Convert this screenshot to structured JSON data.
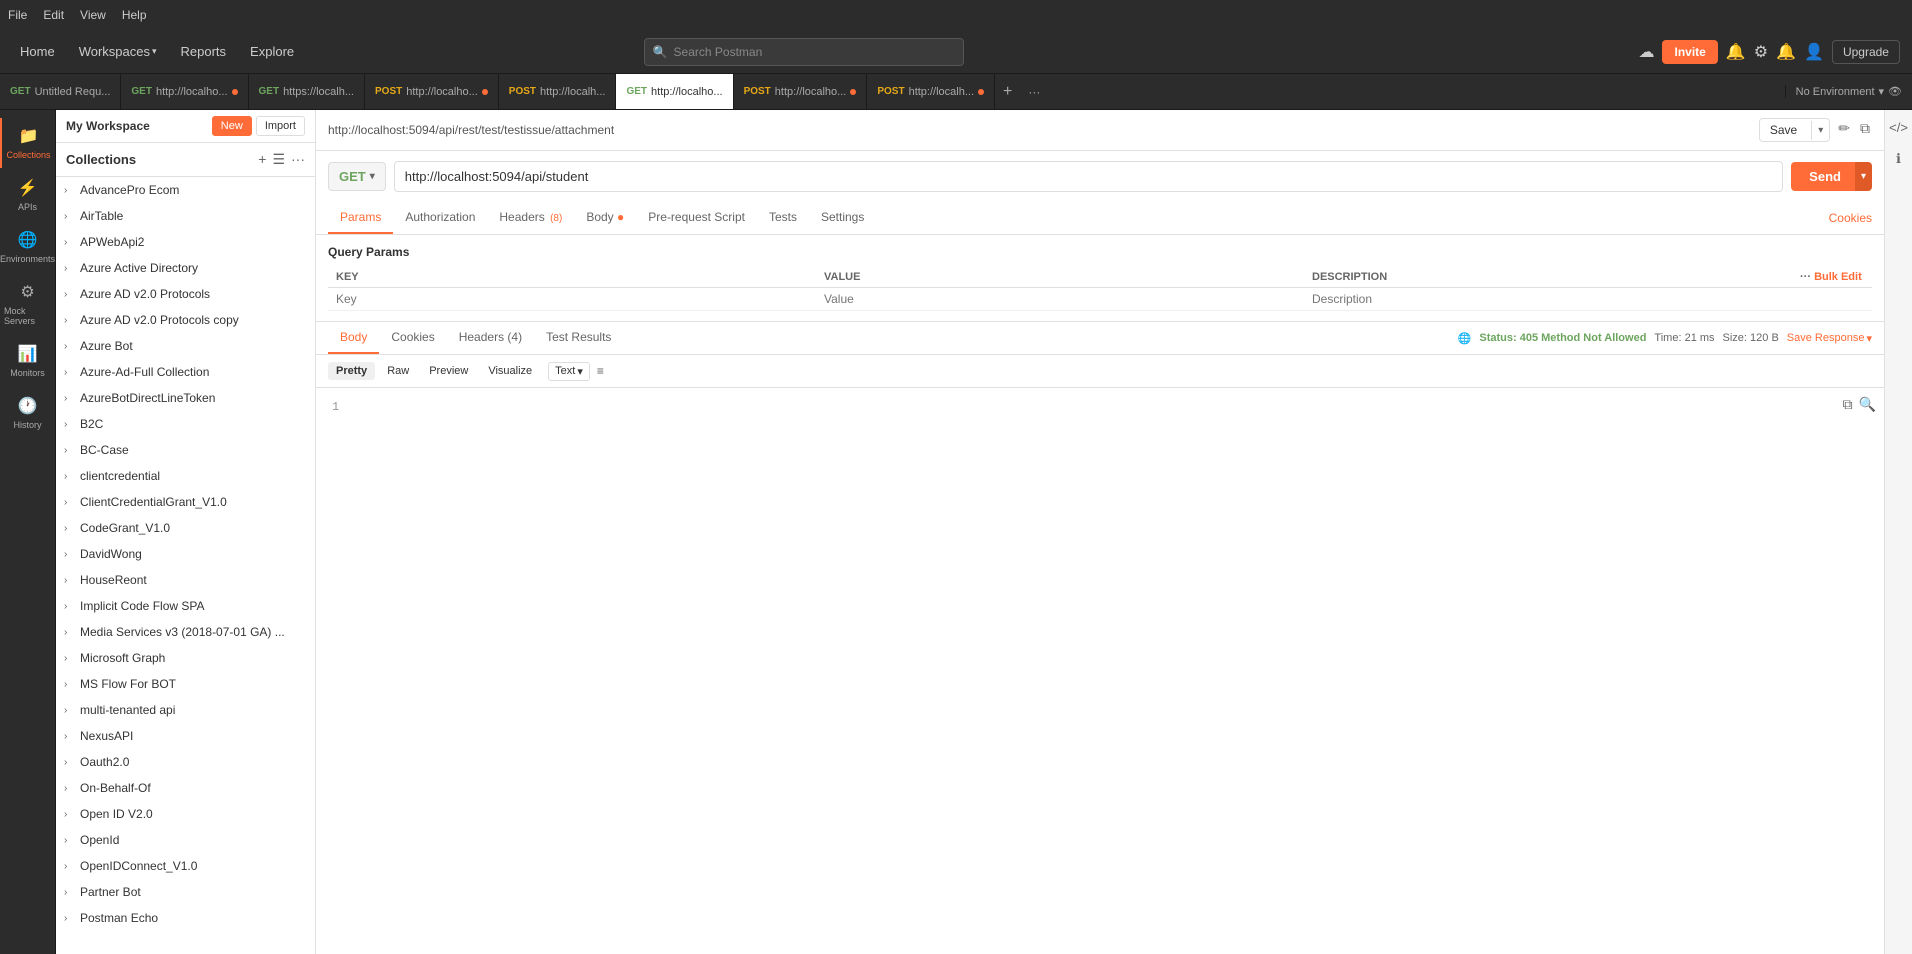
{
  "menubar": {
    "items": [
      "File",
      "Edit",
      "View",
      "Help"
    ]
  },
  "topnav": {
    "home": "Home",
    "workspaces": "Workspaces",
    "reports": "Reports",
    "explore": "Explore",
    "search_placeholder": "Search Postman",
    "invite": "Invite",
    "upgrade": "Upgrade"
  },
  "tabs": [
    {
      "method": "GET",
      "label": "Untitled Requ...",
      "has_dot": false
    },
    {
      "method": "GET",
      "label": "http://localho...",
      "has_dot": true
    },
    {
      "method": "GET",
      "label": "https://localh...",
      "has_dot": false
    },
    {
      "method": "POST",
      "label": "http://localho...",
      "has_dot": true
    },
    {
      "method": "POST",
      "label": "http://localh...",
      "has_dot": false
    },
    {
      "method": "GET",
      "label": "http://localho...",
      "has_dot": false,
      "active": true
    },
    {
      "method": "POST",
      "label": "http://localho...",
      "has_dot": true
    },
    {
      "method": "POST",
      "label": "http://localh...",
      "has_dot": true
    }
  ],
  "environment": "No Environment",
  "sidebar": {
    "items": [
      {
        "id": "collections",
        "icon": "📁",
        "label": "Collections",
        "active": true
      },
      {
        "id": "apis",
        "icon": "⚡",
        "label": "APIs"
      },
      {
        "id": "environments",
        "icon": "🌐",
        "label": "Environments"
      },
      {
        "id": "mock-servers",
        "icon": "⚙",
        "label": "Mock Servers"
      },
      {
        "id": "monitors",
        "icon": "📊",
        "label": "Monitors"
      },
      {
        "id": "history",
        "icon": "🕐",
        "label": "History"
      }
    ]
  },
  "workspace": {
    "name": "My Workspace",
    "new_label": "New",
    "import_label": "Import"
  },
  "collections": {
    "panel_title": "Collections",
    "items": [
      "AdvancePro Ecom",
      "AirTable",
      "APWebApi2",
      "Azure Active Directory",
      "Azure AD v2.0 Protocols",
      "Azure AD v2.0 Protocols copy",
      "Azure Bot",
      "Azure-Ad-Full Collection",
      "AzureBotDirectLineToken",
      "B2C",
      "BC-Case",
      "clientcredential",
      "ClientCredentialGrant_V1.0",
      "CodeGrant_V1.0",
      "DavidWong",
      "HouseReont",
      "Implicit Code Flow SPA",
      "Media Services v3 (2018-07-01 GA) ...",
      "Microsoft Graph",
      "MS Flow For BOT",
      "multi-tenanted api",
      "NexusAPI",
      "Oauth2.0",
      "On-Behalf-Of",
      "Open ID V2.0",
      "OpenId",
      "OpenIDConnect_V1.0",
      "Partner Bot",
      "Postman Echo"
    ]
  },
  "request": {
    "url_breadcrumb": "http://localhost:5094/api/rest/test/testissue/attachment",
    "method": "GET",
    "url": "http://localhost:5094/api/student",
    "send_label": "Send",
    "save_label": "Save",
    "tabs": [
      {
        "id": "params",
        "label": "Params",
        "active": true
      },
      {
        "id": "authorization",
        "label": "Authorization"
      },
      {
        "id": "headers",
        "label": "Headers",
        "badge": "(8)"
      },
      {
        "id": "body",
        "label": "Body",
        "has_dot": true
      },
      {
        "id": "prerequest",
        "label": "Pre-request Script"
      },
      {
        "id": "tests",
        "label": "Tests"
      },
      {
        "id": "settings",
        "label": "Settings"
      }
    ],
    "cookies_link": "Cookies",
    "query_params_label": "Query Params",
    "params_table": {
      "headers": [
        "KEY",
        "VALUE",
        "DESCRIPTION"
      ],
      "key_placeholder": "Key",
      "value_placeholder": "Value",
      "description_placeholder": "Description"
    },
    "bulk_edit_label": "Bulk Edit"
  },
  "response": {
    "tabs": [
      "Body",
      "Cookies",
      "Headers (4)",
      "Test Results"
    ],
    "active_tab": "Body",
    "status": "Status: 405 Method Not Allowed",
    "time": "Time: 21 ms",
    "size": "Size: 120 B",
    "save_response": "Save Response",
    "format_btns": [
      "Pretty",
      "Raw",
      "Preview",
      "Visualize"
    ],
    "active_format": "Pretty",
    "text_format": "Text",
    "line_number": "1",
    "body_content": ""
  }
}
